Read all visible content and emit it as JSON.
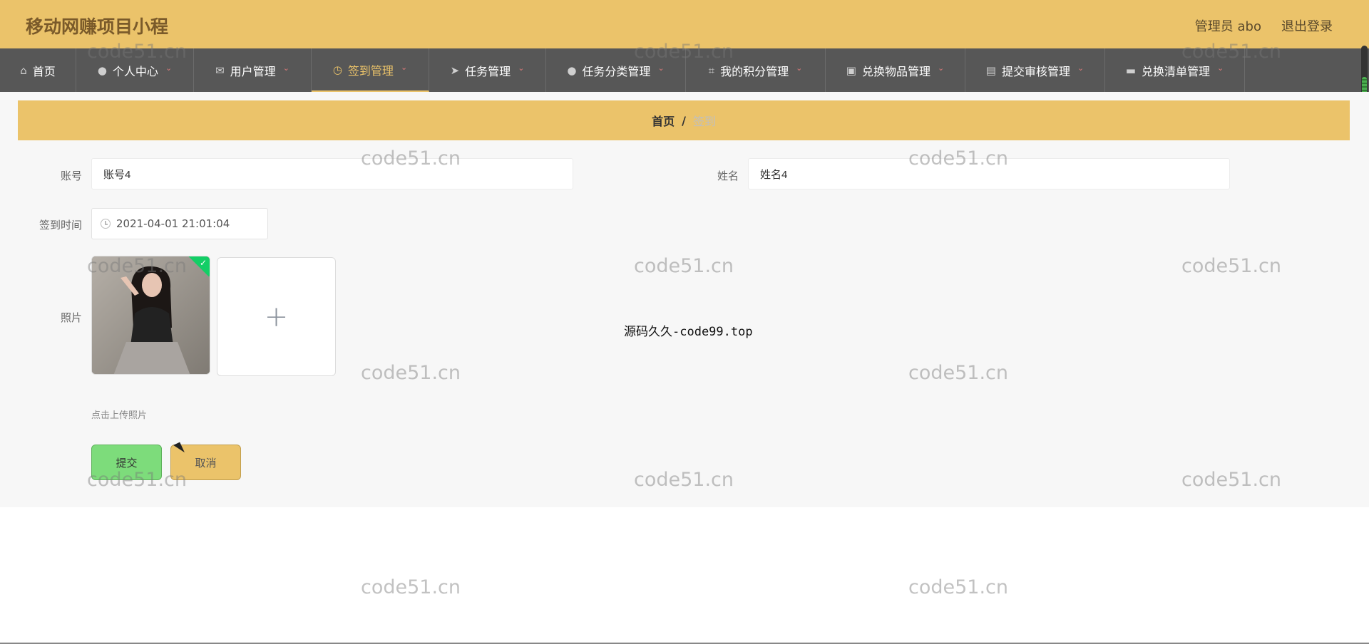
{
  "header": {
    "app_title": "移动网赚项目小程",
    "admin_label": "管理员 abo",
    "logout_label": "退出登录"
  },
  "nav": {
    "items": [
      {
        "label": "首页",
        "icon": "home-icon",
        "has_dropdown": false
      },
      {
        "label": "个人中心",
        "icon": "user-icon",
        "has_dropdown": true
      },
      {
        "label": "用户管理",
        "icon": "mail-icon",
        "has_dropdown": true
      },
      {
        "label": "签到管理",
        "icon": "clock-icon",
        "has_dropdown": true,
        "active": true
      },
      {
        "label": "任务管理",
        "icon": "send-icon",
        "has_dropdown": true
      },
      {
        "label": "任务分类管理",
        "icon": "user-icon",
        "has_dropdown": true
      },
      {
        "label": "我的积分管理",
        "icon": "crop-icon",
        "has_dropdown": true
      },
      {
        "label": "兑换物品管理",
        "icon": "briefcase-icon",
        "has_dropdown": true
      },
      {
        "label": "提交审核管理",
        "icon": "clipboard-icon",
        "has_dropdown": true
      },
      {
        "label": "兑换清单管理",
        "icon": "monitor-icon",
        "has_dropdown": true
      }
    ]
  },
  "breadcrumb": {
    "home": "首页",
    "separator": "/",
    "current": "签到"
  },
  "form": {
    "account_label": "账号",
    "account_value": "账号4",
    "name_label": "姓名",
    "name_value": "姓名4",
    "signin_time_label": "签到时间",
    "signin_time_value": "2021-04-01 21:01:04",
    "photo_label": "照片",
    "upload_hint": "点击上传照片",
    "submit_label": "提交",
    "cancel_label": "取消"
  },
  "overlay_text": "源码久久-code99.top",
  "watermark_text": "code51.cn",
  "colors": {
    "header_bg": "#ebc36a",
    "nav_bg": "#575757",
    "accent": "#ebc36a",
    "submit_bg": "#7ddc7b",
    "success_check": "#13ce66"
  }
}
